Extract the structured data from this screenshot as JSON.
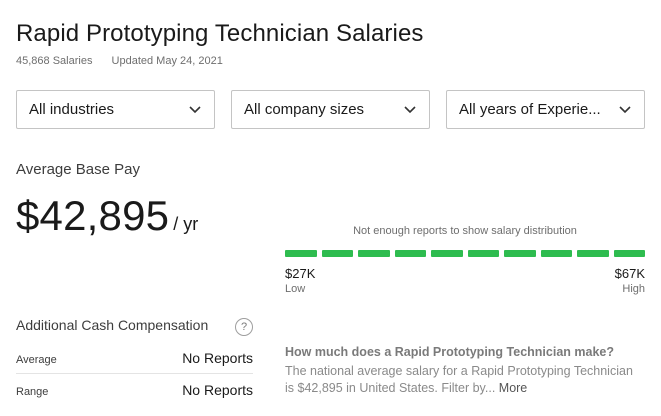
{
  "header": {
    "title": "Rapid Prototyping Technician Salaries",
    "salary_count": "45,868 Salaries",
    "updated": "Updated May 24, 2021"
  },
  "filters": [
    {
      "label": "All industries"
    },
    {
      "label": "All company sizes"
    },
    {
      "label": "All years of Experie..."
    }
  ],
  "pay": {
    "label": "Average Base Pay",
    "amount": "$42,895",
    "unit": "/ yr"
  },
  "distribution": {
    "note": "Not enough reports to show salary distribution",
    "low_value": "$27K",
    "low_label": "Low",
    "high_value": "$67K",
    "high_label": "High",
    "bar_color": "#2ebc4f",
    "segment_count": 10
  },
  "cash": {
    "title": "Additional Cash Compensation",
    "help": "?",
    "rows": [
      {
        "key": "Average",
        "value": "No Reports"
      },
      {
        "key": "Range",
        "value": "No Reports"
      }
    ]
  },
  "faq": {
    "question": "How much does a Rapid Prototyping Technician make?",
    "answer": "The national average salary for a Rapid Prototyping Technician is $42,895 in United States. Filter by...",
    "more": "More"
  }
}
